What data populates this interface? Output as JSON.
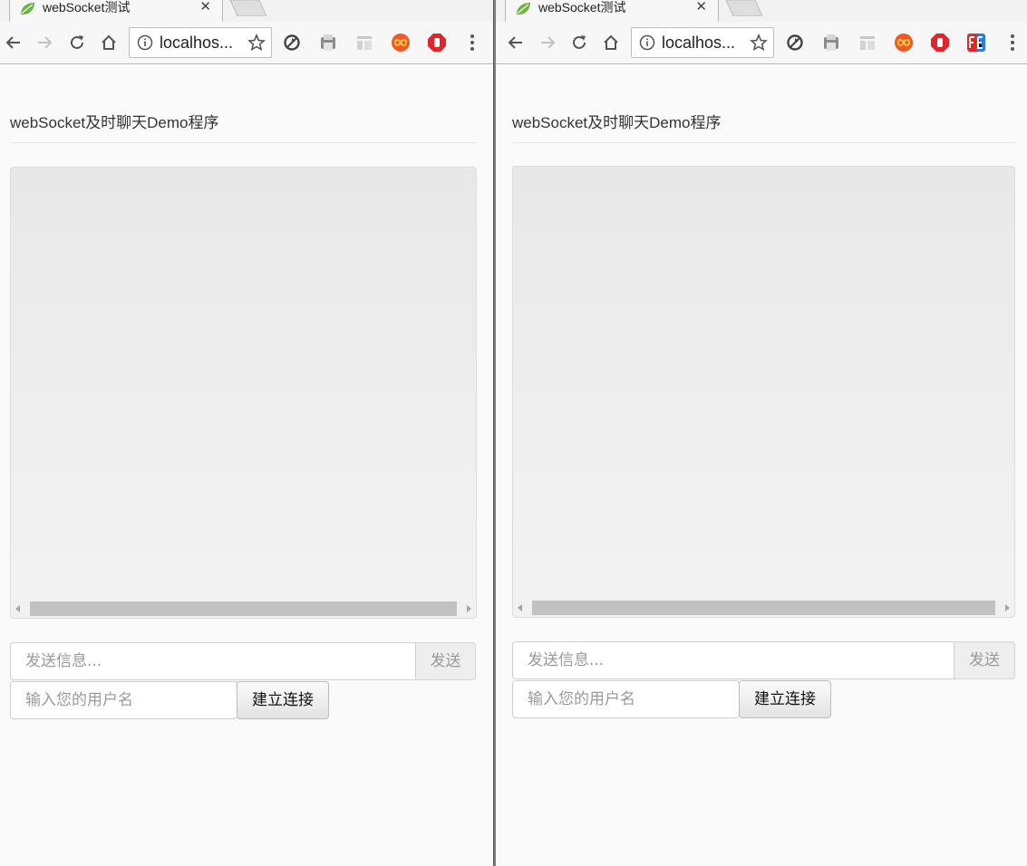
{
  "windows": [
    {
      "id": "left",
      "tab": {
        "title": "webSocket测试",
        "close_glyph": "✕",
        "favicon": "leaf-icon"
      },
      "omnibox": {
        "url": "localhos..."
      },
      "extensions": [
        "sync-icon",
        "print-icon",
        "panel-icon",
        "infinity-icon",
        "adblock-hand-icon"
      ],
      "page": {
        "title": "webSocket及时聊天Demo程序",
        "message_placeholder": "发送信息...",
        "send_label": "发送",
        "username_placeholder": "输入您的用户名",
        "connect_label": "建立连接"
      }
    },
    {
      "id": "right",
      "tab": {
        "title": "webSocket测试",
        "close_glyph": "✕",
        "favicon": "leaf-icon"
      },
      "omnibox": {
        "url": "localhos..."
      },
      "extensions": [
        "sync-icon",
        "print-icon",
        "panel-icon",
        "infinity-icon",
        "adblock-hand-icon",
        "fe-icon"
      ],
      "page": {
        "title": "webSocket及时聊天Demo程序",
        "message_placeholder": "发送信息...",
        "send_label": "发送",
        "username_placeholder": "输入您的用户名",
        "connect_label": "建立连接"
      }
    }
  ],
  "colors": {
    "page_background": "#fafafa",
    "chat_panel": "#e9e9e9",
    "scrollbar_thumb": "#c1c1c1",
    "infinity_accent": "#f05a28",
    "adblock_red": "#e0252b",
    "fe_red": "#e32626",
    "fe_blue": "#2a7be4"
  }
}
